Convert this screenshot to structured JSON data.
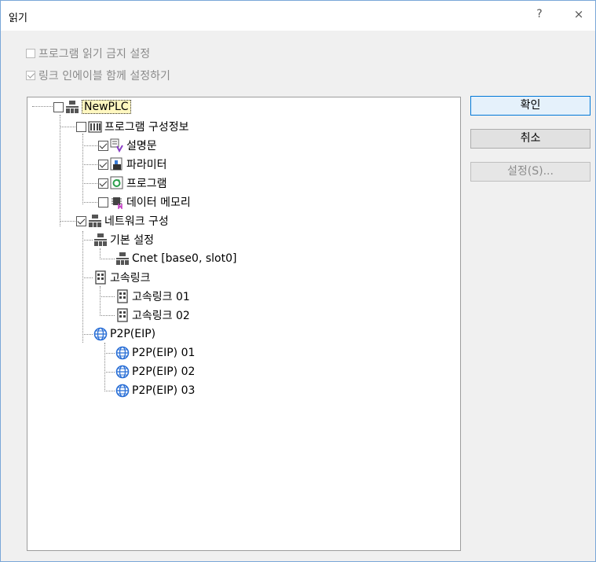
{
  "window": {
    "title": "읽기",
    "help": "?",
    "close": "×"
  },
  "options": {
    "prohibit_read": {
      "label": "프로그램 읽기 금지 설정",
      "checked": false
    },
    "link_enable": {
      "label": "링크 인에이블 함께 설정하기",
      "checked": true
    }
  },
  "tree": {
    "root": "NewPLC",
    "program_config": "프로그램 구성정보",
    "comment": "설명문",
    "parameter": "파라미터",
    "program": "프로그램",
    "data_memory": "데이터 메모리",
    "network_config": "네트워크 구성",
    "basic_settings": "기본 설정",
    "cnet": "Cnet [base0, slot0]",
    "highspeed_link": "고속링크",
    "highspeed_link_01": "고속링크 01",
    "highspeed_link_02": "고속링크 02",
    "p2p": "P2P(EIP)",
    "p2p_01": "P2P(EIP) 01",
    "p2p_02": "P2P(EIP) 02",
    "p2p_03": "P2P(EIP) 03"
  },
  "buttons": {
    "ok": "확인",
    "cancel": "취소",
    "settings": "설정(S)..."
  },
  "colors": {
    "accent": "#0078d7",
    "selection": "#fff7c0"
  }
}
